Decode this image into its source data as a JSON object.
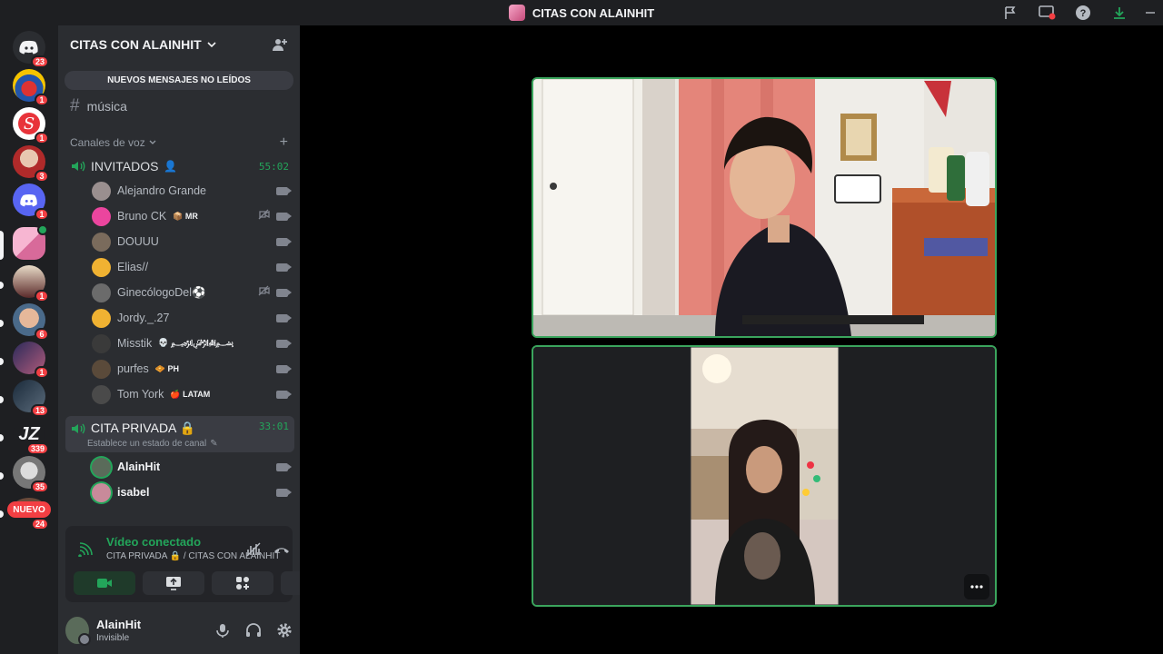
{
  "window": {
    "title": "CITAS CON ALAINHIT"
  },
  "rail": {
    "servers": [
      {
        "icon": "discord-dm-icon",
        "badge": "23"
      },
      {
        "icon": "server-ecuador-icon",
        "badge": "1"
      },
      {
        "icon": "server-s-icon",
        "badge": "1"
      },
      {
        "icon": "server-avatar-red-icon",
        "badge": "3"
      },
      {
        "icon": "discord-server-icon",
        "badge": "1"
      },
      {
        "icon": "server-citas-icon",
        "badge": ""
      },
      {
        "icon": "server-portrait-icon",
        "badge": "1"
      },
      {
        "icon": "server-face-icon",
        "badge": "6"
      },
      {
        "icon": "server-anime-icon",
        "badge": "1"
      },
      {
        "icon": "server-soldier-icon",
        "badge": "13"
      },
      {
        "icon": "server-jz-icon",
        "badge": "339",
        "label": "JZ"
      },
      {
        "icon": "server-cat-icon",
        "badge": "35"
      },
      {
        "icon": "server-new-icon",
        "badge": "24"
      }
    ],
    "new_label": "NUEVO"
  },
  "sidebar": {
    "guild_name": "CITAS CON ALAINHIT",
    "unread_banner": "NUEVOS MENSAJES NO LEÍDOS",
    "text_channel": "música",
    "voice_category": "Canales de voz",
    "invitados": {
      "name": "INVITADOS",
      "timer": "55:02",
      "members": [
        {
          "name": "Alejandro Grande",
          "tag": "",
          "color": "#9a8f8f"
        },
        {
          "name": "Bruno CK",
          "tag": "📦 MR",
          "color": "#eb459e"
        },
        {
          "name": "DOUUU",
          "tag": "",
          "color": "#7a6b5c"
        },
        {
          "name": "Elias//",
          "tag": "",
          "color": "#f0b232"
        },
        {
          "name": "GinecólogoDel⚽",
          "tag": "",
          "color": "#6b6b6b"
        },
        {
          "name": "Jordy._.27",
          "tag": "",
          "color": "#f0b232"
        },
        {
          "name": "Misstik",
          "tag": "💀 ﷽",
          "color": "#3a3a3a"
        },
        {
          "name": "purfes",
          "tag": "🧇 PH",
          "color": "#5a4a3a"
        },
        {
          "name": "Tom York",
          "tag": "🍎 LATAM",
          "color": "#4a4a4a"
        }
      ]
    },
    "cita_privada": {
      "name": "CITA PRIVADA 🔒",
      "timer": "33:01",
      "status": "Establece un estado de canal",
      "members": [
        {
          "name": "AlainHit",
          "color": "#5a6b5a"
        },
        {
          "name": "isabel",
          "color": "#c88a9a"
        }
      ]
    }
  },
  "voice_panel": {
    "status": "Vídeo conectado",
    "location": "CITA PRIVADA 🔒 / CITAS CON ALAINHIT"
  },
  "user_panel": {
    "username": "AlainHit",
    "status": "Invisible"
  }
}
